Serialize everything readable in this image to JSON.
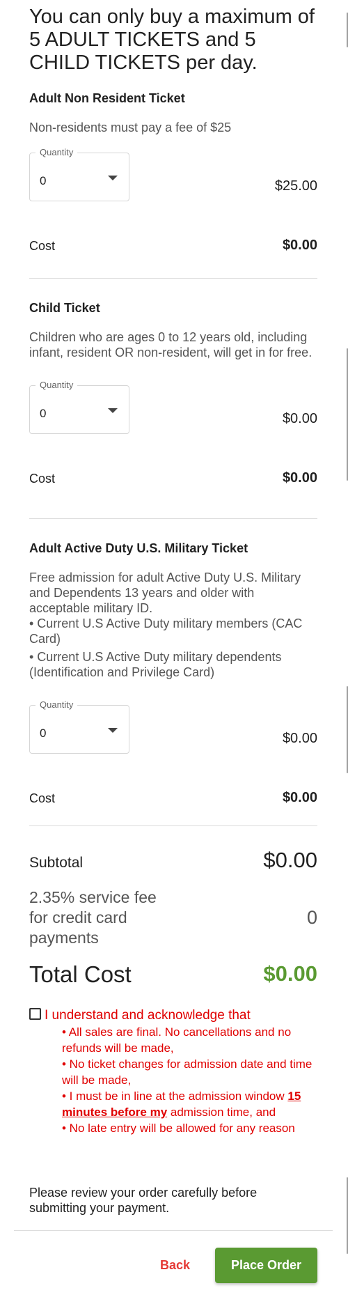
{
  "notice": "You can only buy a maximum of 5 ADULT TICKETS and 5 CHILD TICKETS per day.",
  "tickets": [
    {
      "title": "Adult Non Resident Ticket",
      "description": "Non-residents must pay a fee of $25",
      "bullets": [],
      "quantity_label": "Quantity",
      "quantity_value": "0",
      "unit_price": "$25.00",
      "cost_label": "Cost",
      "cost_value": "$0.00"
    },
    {
      "title": "Child Ticket",
      "description": "Children who are ages 0 to 12 years old, including infant, resident OR non-resident, will get in for free.",
      "bullets": [],
      "quantity_label": "Quantity",
      "quantity_value": "0",
      "unit_price": "$0.00",
      "cost_label": "Cost",
      "cost_value": "$0.00"
    },
    {
      "title": "Adult Active Duty U.S. Military Ticket",
      "description": "Free admission for adult Active Duty U.S. Military and Dependents 13 years and older with acceptable military ID.",
      "bullets": [
        "• Current U.S Active Duty military members (CAC Card)",
        "• Current U.S Active Duty military dependents (Identification and Privilege Card)"
      ],
      "quantity_label": "Quantity",
      "quantity_value": "0",
      "unit_price": "$0.00",
      "cost_label": "Cost",
      "cost_value": "$0.00"
    }
  ],
  "summary": {
    "subtotal_label": "Subtotal",
    "subtotal_value": "$0.00",
    "fee_label": "2.35% service fee for credit card payments",
    "fee_value": "0",
    "total_label": "Total Cost",
    "total_value": "$0.00"
  },
  "acknowledgement": {
    "checked": false,
    "heading": "I understand and acknowledge that",
    "item1": "• All sales are final. No cancellations and no refunds will be made,",
    "item2": "• No ticket changes for admission date and time will be made,",
    "item3_prefix": "• I must be in line at the admission window ",
    "item3_strong": "15 minutes before my",
    "item3_suffix": " admission time, and",
    "item4": "• No late entry will be allowed for any reason"
  },
  "review_text": "Please review your order carefully before submitting your payment.",
  "actions": {
    "back_label": "Back",
    "place_order_label": "Place Order"
  },
  "colors": {
    "accent_green": "#5a9a32",
    "warning_red": "#e00000",
    "back_red": "#e53935"
  }
}
